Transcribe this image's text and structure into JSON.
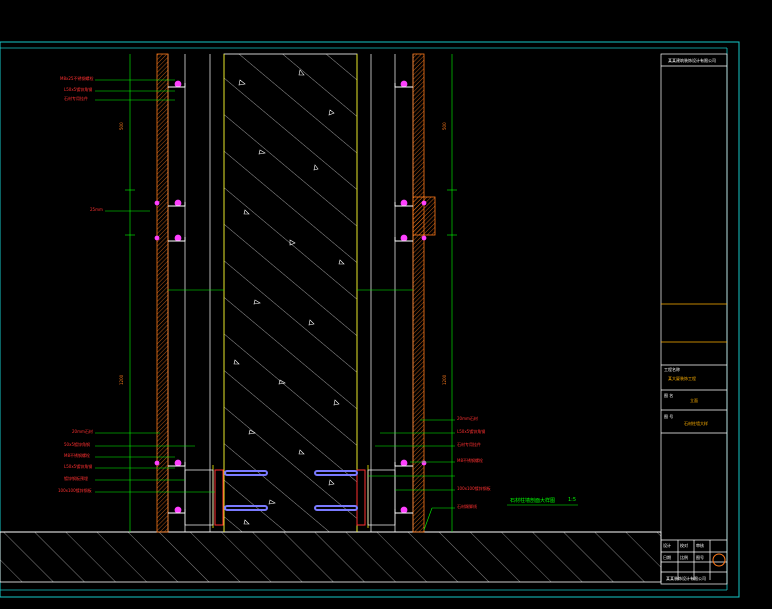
{
  "drawing": {
    "title": "石材柱墙剖面大样图",
    "scale": "1:5",
    "colors": {
      "background": "#000000",
      "border": "#16c8c8",
      "concrete_hatch": "#ffffff",
      "stone": "#ff7a1a",
      "leaders": "#00ff00",
      "labels": "#ff3030",
      "anchors": "#ff40ff",
      "bolts": "#7a7aff",
      "frame_yellow": "#f0f000"
    },
    "labels_left_top": [
      "M8x25不锈钢螺栓",
      "L50x5镀锌角钢",
      "石材专用挂件"
    ],
    "labels_left_mid": [
      "25mm"
    ],
    "labels_left_bottom": [
      "20mm石材",
      "50x5镀锌角钢",
      "M8不锈钢螺栓",
      "L50x5镀锌角钢",
      "镀锌钢板预埋",
      "100x100镀锌钢板"
    ],
    "labels_right_bottom": [
      "20mm石材",
      "L50x5镀锌角钢",
      "石材专用挂件",
      "M8不锈钢螺栓",
      "100x100镀锌钢板"
    ],
    "labels_right_floor": [
      "石材踢脚线"
    ]
  },
  "title_block": {
    "company": "某某建筑装饰设计有限公司",
    "project_label": "工程名称",
    "project_value": "某大厦装饰工程",
    "drawing_label": "图 名",
    "drawing_value": "立面",
    "number_label": "图 号",
    "number_value": "石材柱墙大样",
    "footer_cells": [
      "设计",
      "校对",
      "审核",
      "日期",
      "比例",
      "图号"
    ],
    "footer_note": "某某装饰设计有限公司"
  }
}
